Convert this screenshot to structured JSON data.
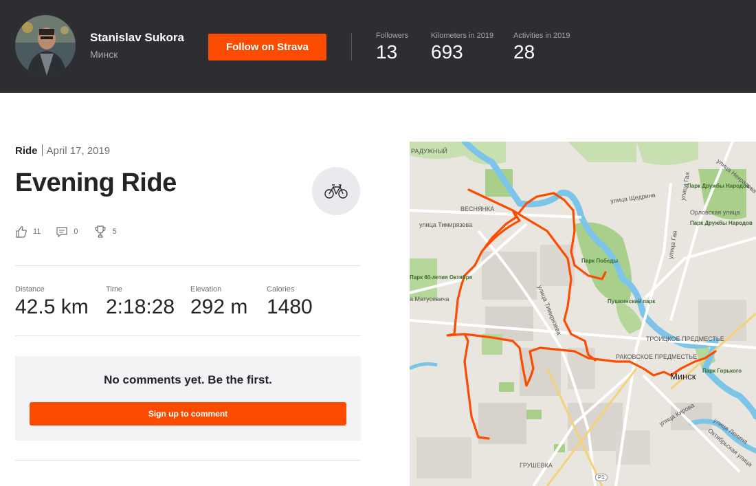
{
  "header": {
    "athlete_name": "Stanislav Sukora",
    "location": "Минск",
    "follow_label": "Follow on Strava",
    "stats": [
      {
        "label": "Followers",
        "value": "13"
      },
      {
        "label": "Kilometers in 2019",
        "value": "693"
      },
      {
        "label": "Activities in 2019",
        "value": "28"
      }
    ]
  },
  "activity": {
    "type": "Ride",
    "date": "April 17, 2019",
    "title": "Evening Ride",
    "sport_icon": "bicycle-icon",
    "kudos": "11",
    "comments": "0",
    "achievements": "5",
    "stats": [
      {
        "label": "Distance",
        "value": "42.5 km"
      },
      {
        "label": "Time",
        "value": "2:18:28"
      },
      {
        "label": "Elevation",
        "value": "292 m"
      },
      {
        "label": "Calories",
        "value": "1480"
      }
    ]
  },
  "comments_section": {
    "empty_text": "No comments yet. Be the first.",
    "signup_label": "Sign up to comment"
  },
  "map": {
    "route_color": "#fc4c02",
    "labels": {
      "raduzhny": "РАДУЖНЫЙ",
      "vesnyanka": "ВЕСНЯНКА",
      "timiryazeva": "улица Тимирязева",
      "timiryazeva2": "улица Тимирязева",
      "shchedrina": "улица Щедрина",
      "orlovskaya": "Орловская улица",
      "nekrasova": "улица Некрасова",
      "gaya": "улица Гая",
      "gaya2": "улица Гая",
      "park_druzhby1": "Парк Дружбы Народов",
      "park_druzhby2": "Парк Дружбы Народов",
      "park_pobedy": "Парк Победы",
      "park_60": "Парк 60-летия Октября",
      "matusevicha": "а.Матусевича",
      "pushkinsky": "Пушкинский парк",
      "troitskoye": "ТРОИЦКОЕ ПРЕДМЕСТЬЕ",
      "rakovskoye": "РАКОВСКОЕ ПРЕДМЕСТЬЕ",
      "minsk": "Минск",
      "park_gorkogo": "Парк Горького",
      "kirova": "улица Кирова",
      "lenina": "улица Ленина",
      "oktyabrskaya": "Октябрьская улица",
      "grushevka": "ГРУШЕВКА",
      "p1": "P1"
    }
  }
}
